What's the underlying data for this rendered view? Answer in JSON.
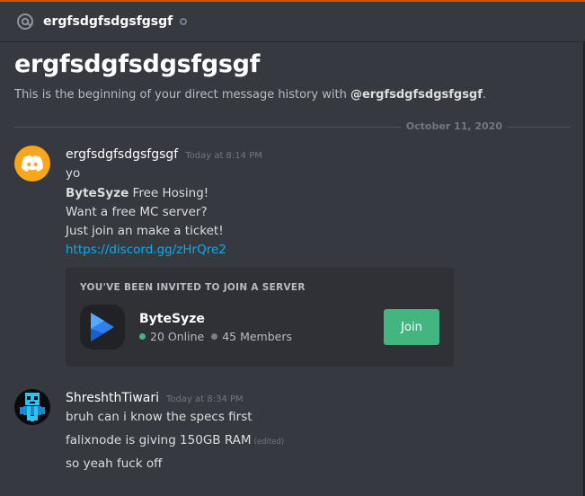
{
  "colors": {
    "background": "#36393f",
    "accent_strip": "#d35400",
    "link": "#00b0f4",
    "online": "#43b581",
    "join_button": "#43b581",
    "discord_orange_avatar": "#faa61a"
  },
  "header": {
    "name": "ergfsdgfsdgsfgsgf",
    "icon": "at-icon",
    "status_icon": "offline-status-icon"
  },
  "welcome": {
    "title": "ergfsdgfsdgsfgsgf",
    "subtitle_prefix": "This is the beginning of your direct message history with ",
    "subtitle_user": "@ergfsdgfsdgsfgsgf",
    "subtitle_suffix": "."
  },
  "divider": {
    "date": "October 11, 2020"
  },
  "messages": [
    {
      "author": "ergfsdgfsdgsfgsgf",
      "timestamp": "Today at 8:14 PM",
      "avatar_icon": "discord-logo-icon",
      "lines": {
        "l1": "yo",
        "l2_bold": "ByteSyze",
        "l2_rest": " Free Hosing!",
        "l3": "Want a free MC server?",
        "l4": "Just join an make a ticket!",
        "link": "https://discord.gg/zHrQre2"
      },
      "invite": {
        "header": "YOU'VE BEEN INVITED TO JOIN A SERVER",
        "server_name": "ByteSyze",
        "online": "20 Online",
        "members": "45 Members",
        "join_label": "Join",
        "server_icon": "bytesyze-play-icon"
      }
    },
    {
      "author": "ShreshthTiwari",
      "timestamp": "Today at 8:34 PM",
      "avatar_icon": "pixel-skull-avatar-icon",
      "lines": {
        "l1": "bruh can i know the specs first",
        "l2": "falixnode is giving 150GB RAM",
        "l2_edited": "(edited)",
        "l3": "so yeah fuck off"
      }
    }
  ]
}
